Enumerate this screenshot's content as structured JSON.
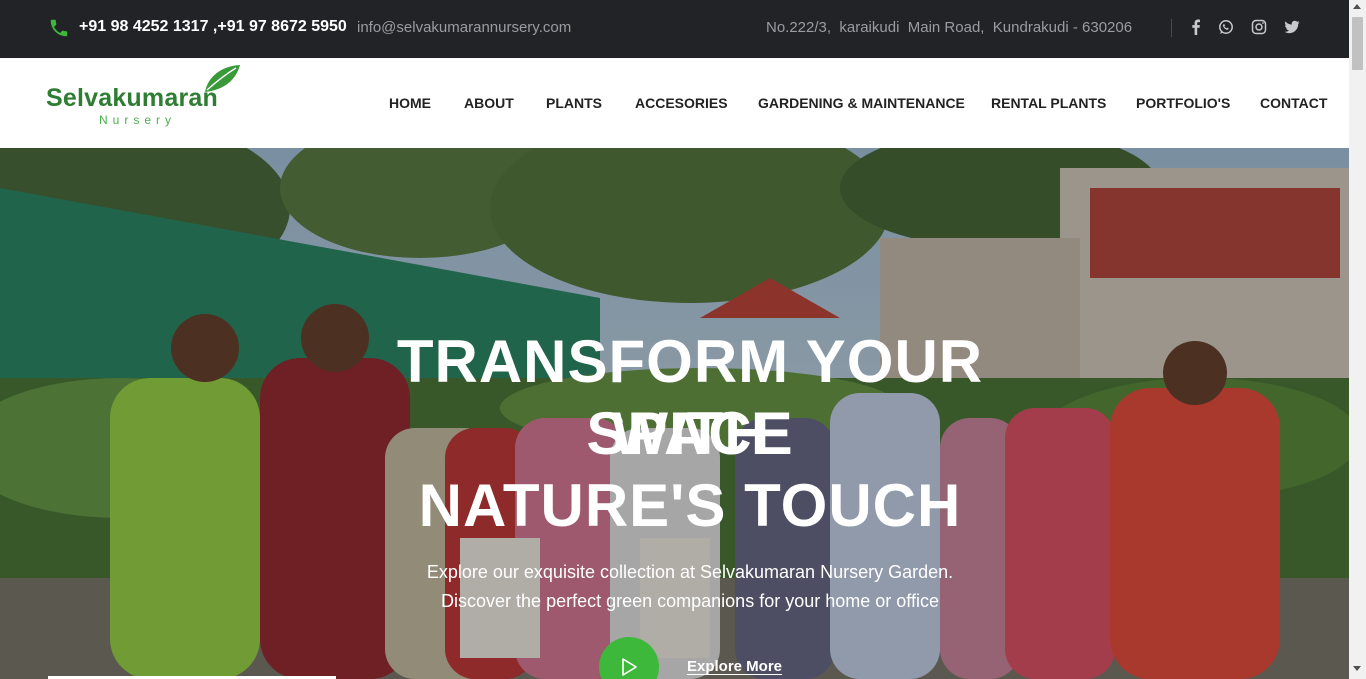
{
  "topbar": {
    "phone": "+91 98 4252 1317 ,+91 97 8672 5950",
    "email": "info@selvakumarannursery.com",
    "address": "No.222/3,  karaikudi  Main Road,  Kundrakudi - 630206",
    "social_icons": [
      "facebook-icon",
      "whatsapp-icon",
      "instagram-icon",
      "twitter-icon"
    ]
  },
  "logo": {
    "main": "Selvakumaran",
    "sub": "Nursery"
  },
  "nav": {
    "home": "HOME",
    "about": "ABOUT",
    "plants": "PLANTS",
    "accesories": "ACCESORIES",
    "gardening": "GARDENING & MAINTENANCE",
    "rental": "RENTAL PLANTS",
    "portfolio": "PORTFOLIO'S",
    "contact": "CONTACT"
  },
  "hero": {
    "title_line1": "TRANSFORM YOUR SPACE",
    "title_line2": "WITH",
    "title_line3": "NATURE'S TOUCH",
    "subtitle_line1": "Explore our exquisite collection at Selvakumaran Nursery Garden.",
    "subtitle_line2": "Discover the perfect green companions for your home or office",
    "cta": "Explore More"
  },
  "colors": {
    "brand_green": "#2e7d32",
    "accent_green": "#3db83a",
    "topbar_bg": "#222327",
    "muted_text": "#9a9ca3"
  }
}
